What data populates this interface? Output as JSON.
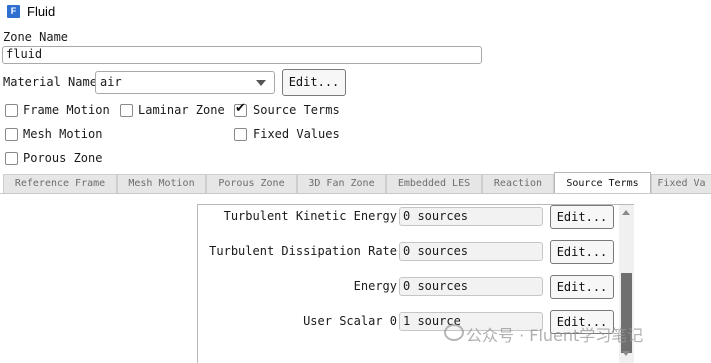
{
  "window": {
    "title": "Fluid",
    "icon_letter": "F",
    "icon_color": "#2f6fd0"
  },
  "zone": {
    "name_label": "Zone Name",
    "name_value": "fluid"
  },
  "material": {
    "label": "Material Name",
    "selected": "air",
    "edit_label": "Edit..."
  },
  "options": [
    {
      "label": "Frame Motion",
      "checked": false
    },
    {
      "label": "Laminar Zone",
      "checked": false
    },
    {
      "label": "Source Terms",
      "checked": true
    },
    {
      "label": "Mesh Motion",
      "checked": false
    },
    {
      "label": "Fixed Values",
      "checked": false
    },
    {
      "label": "Porous Zone",
      "checked": false
    }
  ],
  "tabs": [
    {
      "label": "Reference Frame",
      "active": false
    },
    {
      "label": "Mesh Motion",
      "active": false
    },
    {
      "label": "Porous Zone",
      "active": false
    },
    {
      "label": "3D Fan Zone",
      "active": false
    },
    {
      "label": "Embedded LES",
      "active": false
    },
    {
      "label": "Reaction",
      "active": false
    },
    {
      "label": "Source Terms",
      "active": true
    },
    {
      "label": "Fixed Va",
      "active": false
    }
  ],
  "source_terms": [
    {
      "label": "Turbulent Kinetic Energy",
      "value": "0 sources",
      "edit_label": "Edit..."
    },
    {
      "label": "Turbulent Dissipation Rate",
      "value": "0 sources",
      "edit_label": "Edit..."
    },
    {
      "label": "Energy",
      "value": "0 sources",
      "edit_label": "Edit..."
    },
    {
      "label": "User Scalar 0",
      "value": "1 source",
      "edit_label": "Edit..."
    }
  ],
  "watermark": {
    "text": "公众号 · Fluent学习笔记"
  }
}
